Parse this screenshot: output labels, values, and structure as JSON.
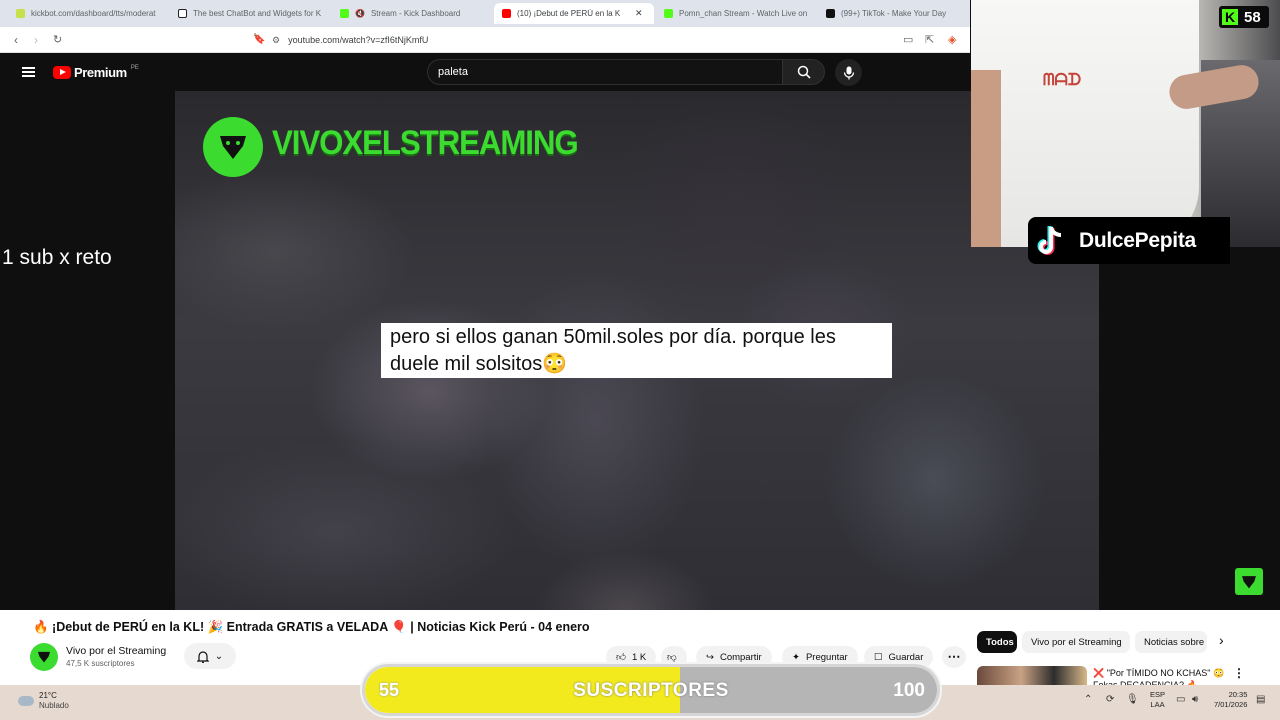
{
  "browser": {
    "tabs": [
      {
        "title": "kickbot.com/dashboard/tts/moderat",
        "color": "#c6e04a"
      },
      {
        "title": "The best ChatBot and Widgets for K",
        "color": "#222222"
      },
      {
        "title": "Stream - Kick Dashboard",
        "color": "#53fc18"
      },
      {
        "title": "(10) ¡Debut de PERÚ en la K",
        "color": "#ff0000",
        "active": true
      },
      {
        "title": "Pomn_chan Stream - Watch Live on",
        "color": "#53fc18"
      },
      {
        "title": "(99+) TikTok - Make Your Day",
        "color": "#111111"
      }
    ],
    "url": "youtube.com/watch?v=zfI6tNjKmfU"
  },
  "youtube": {
    "logo_text": "Premium",
    "region": "PE",
    "search_value": "paleta"
  },
  "video": {
    "brand_name": "VIVOXELSTREAMING",
    "caption": "pero si ellos ganan 50mil.soles por día. porque les duele mil solsitos😳"
  },
  "overlay": {
    "left_text": "1 sub x reto",
    "kick_viewers": "58",
    "tiktok_name": "DulcePepita"
  },
  "info": {
    "title": "🔥 ¡Debut de PERÚ en la KL! 🎉 Entrada GRATIS a VELADA 🎈 | Noticias Kick Perú - 04 enero",
    "channel_name": "Vivo por el Streaming",
    "subscribers": "47,5 K suscriptores",
    "likes": "1 K",
    "share": "Compartir",
    "ask": "Preguntar",
    "save": "Guardar",
    "chips": [
      "Todos",
      "Vivo por el Streaming",
      "Noticias sobre p"
    ],
    "rec_title_1": "❌ \"Por TÍMIDO NO KCHAS\" 😳",
    "rec_title_2": "Fokas DECADENCIA? 🔥"
  },
  "goal": {
    "current": "55",
    "label": "SUSCRIPTORES",
    "max": "100",
    "progress": 0.55
  },
  "taskbar": {
    "temp": "21°C",
    "condition": "Nublado",
    "lang_1": "ESP",
    "lang_2": "LAA",
    "time": "20:35",
    "date": "7/01/2026"
  }
}
